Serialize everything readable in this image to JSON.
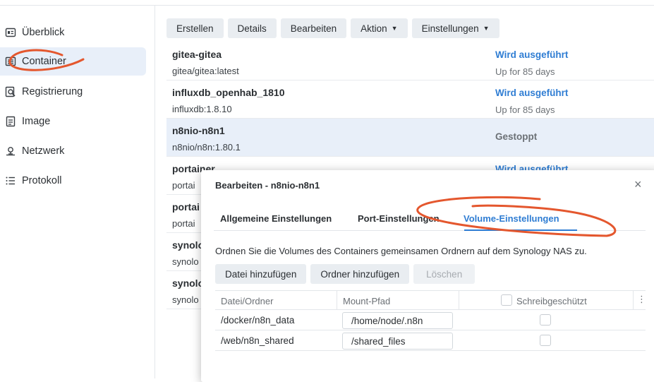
{
  "sidebar": {
    "items": [
      {
        "label": "Überblick",
        "icon": "overview-icon",
        "active": false
      },
      {
        "label": "Container",
        "icon": "container-icon",
        "active": true
      },
      {
        "label": "Registrierung",
        "icon": "registry-search-icon",
        "active": false
      },
      {
        "label": "Image",
        "icon": "image-icon",
        "active": false
      },
      {
        "label": "Netzwerk",
        "icon": "network-icon",
        "active": false
      },
      {
        "label": "Protokoll",
        "icon": "log-list-icon",
        "active": false
      }
    ]
  },
  "toolbar": {
    "create": "Erstellen",
    "details": "Details",
    "edit": "Bearbeiten",
    "action": "Aktion",
    "settings": "Einstellungen"
  },
  "containers": [
    {
      "name": "gitea-gitea",
      "image": "gitea/gitea:latest",
      "status": "Wird ausgeführt",
      "uptime": "Up for 85 days"
    },
    {
      "name": "influxdb_openhab_1810",
      "image": "influxdb:1.8.10",
      "status": "Wird ausgeführt",
      "uptime": "Up for 85 days"
    },
    {
      "name": "n8nio-n8n1",
      "image": "n8nio/n8n:1.80.1",
      "status": "Gestoppt",
      "uptime": ""
    },
    {
      "name": "portainer",
      "image": "portai",
      "status": "Wird ausgeführt",
      "uptime": ""
    },
    {
      "name": "portai",
      "image": "portai",
      "status": "",
      "uptime": ""
    },
    {
      "name": "synolo",
      "image": "synolo",
      "status": "",
      "uptime": ""
    },
    {
      "name": "synolo",
      "image": "synolo",
      "status": "",
      "uptime": ""
    }
  ],
  "dialog": {
    "title": "Bearbeiten - n8nio-n8n1",
    "close": "×",
    "tabs": [
      "Allgemeine Einstellungen",
      "Port-Einstellungen",
      "Volume-Einstellungen"
    ],
    "active_tab": "Volume-Einstellungen",
    "description": "Ordnen Sie die Volumes des Containers gemeinsamen Ordnern auf dem Synology NAS zu.",
    "buttons": {
      "add_file": "Datei hinzufügen",
      "add_folder": "Ordner hinzufügen",
      "delete": "Löschen"
    },
    "table": {
      "headers": {
        "path": "Datei/Ordner",
        "mount": "Mount-Pfad",
        "readonly": "Schreibgeschützt"
      },
      "rows": [
        {
          "path": "/docker/n8n_data",
          "mount": "/home/node/.n8n",
          "readonly": false
        },
        {
          "path": "/web/n8n_shared",
          "mount": "/shared_files",
          "readonly": false
        }
      ]
    }
  },
  "colors": {
    "accent": "#2f7dd3",
    "selected_row": "#e8eff9",
    "annotation": "#e4572e"
  }
}
